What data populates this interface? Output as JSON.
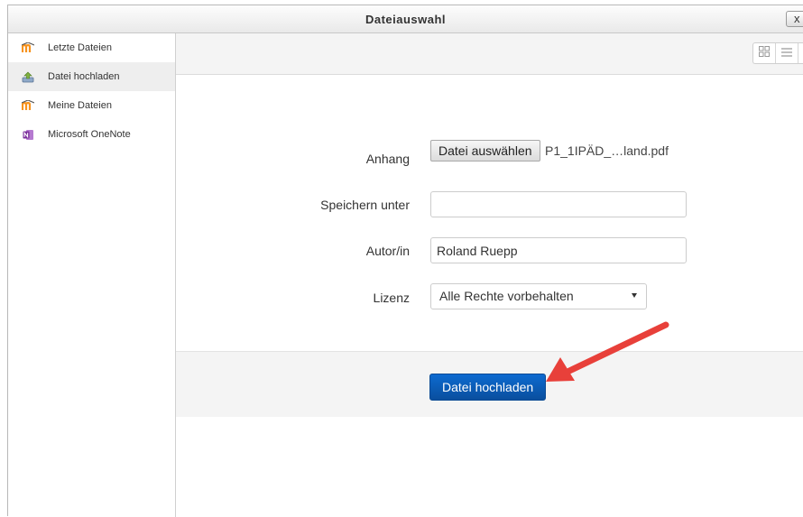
{
  "dialog": {
    "title": "Dateiauswahl",
    "close_label": "x"
  },
  "sidebar": {
    "items": [
      {
        "label": "Letzte Dateien",
        "icon": "moodle-icon",
        "active": false
      },
      {
        "label": "Datei hochladen",
        "icon": "upload-icon",
        "active": true
      },
      {
        "label": "Meine Dateien",
        "icon": "moodle-icon",
        "active": false
      },
      {
        "label": "Microsoft OneNote",
        "icon": "onenote-icon",
        "active": false
      }
    ]
  },
  "toolbar": {
    "views": [
      "icons-view",
      "list-view",
      "tree-view"
    ]
  },
  "form": {
    "attachment_label": "Anhang",
    "choose_file_label": "Datei auswählen",
    "file_name": "P1_1IPÄD_…land.pdf",
    "save_as_label": "Speichern unter",
    "save_as_value": "",
    "author_label": "Autor/in",
    "author_value": "Roland Ruepp",
    "license_label": "Lizenz",
    "license_value": "Alle Rechte vorbehalten"
  },
  "footer": {
    "upload_button_label": "Datei hochladen"
  },
  "colors": {
    "primary_button": "#0a5cb8",
    "annotation_arrow": "#e8403a",
    "moodle_orange": "#f7931e",
    "onenote_purple": "#7a2f9b"
  }
}
